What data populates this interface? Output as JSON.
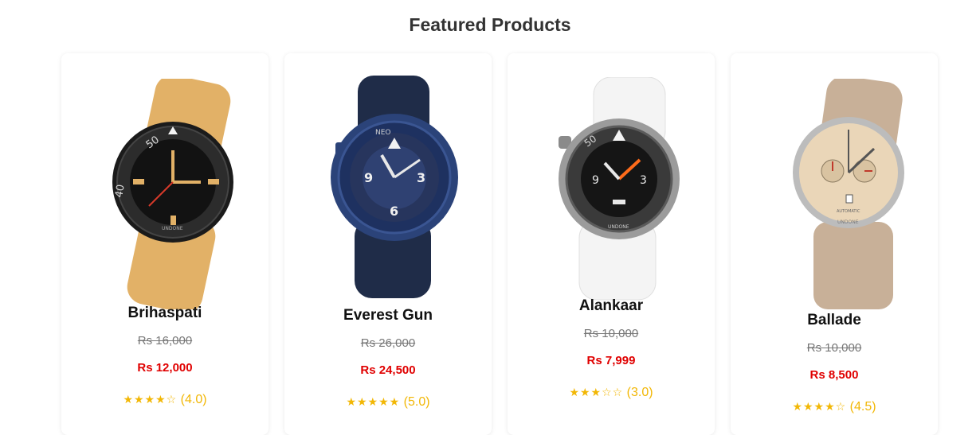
{
  "section": {
    "title": "Featured Products"
  },
  "colors": {
    "sale_price": "#e00000",
    "star": "#f2b705",
    "old_price": "#777777"
  },
  "products": [
    {
      "name": "Brihaspati",
      "old_price": "Rs 16,000",
      "price": "Rs 12,000",
      "stars": "★★★★☆",
      "rating": "(4.0)",
      "image_icon": "watch-black-tan-strap"
    },
    {
      "name": "Everest Gun",
      "old_price": "Rs 26,000",
      "price": "Rs 24,500",
      "stars": "★★★★★",
      "rating": "(5.0)",
      "image_icon": "watch-blue-navy-strap"
    },
    {
      "name": "Alankaar",
      "old_price": "Rs 10,000",
      "price": "Rs 7,999",
      "stars": "★★★☆☆",
      "rating": "(3.0)",
      "image_icon": "watch-steel-white-strap"
    },
    {
      "name": "Ballade",
      "old_price": "Rs 10,000",
      "price": "Rs 8,500",
      "stars": "★★★★☆",
      "rating": "(4.5)",
      "image_icon": "watch-cream-suede-strap"
    }
  ]
}
